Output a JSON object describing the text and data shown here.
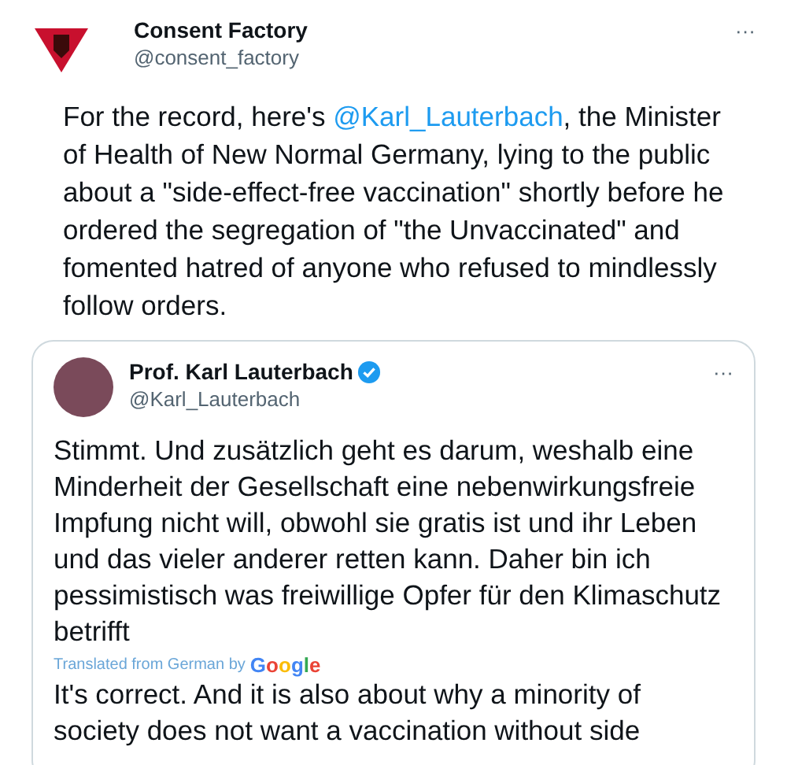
{
  "tweet": {
    "author": {
      "name": "Consent Factory",
      "handle": "@consent_factory"
    },
    "text": {
      "before": "For the record, here's ",
      "mention": "@Karl_Lauterbach",
      "after": ", the Minister of Health of New Normal Germany, lying to the public about a \"side-effect-free vaccination\" shortly before he ordered the segregation of \"the Unvaccinated\" and fomented hatred of anyone who refused to mindlessly follow orders."
    },
    "more": "···",
    "quoted": {
      "author": {
        "name": "Prof. Karl Lauterbach",
        "handle": "@Karl_Lauterbach",
        "verified": true
      },
      "more": "···",
      "text": "Stimmt. Und zusätzlich geht es darum, weshalb eine Minderheit der Gesellschaft eine nebenwirkungsfreie Impfung nicht will, obwohl sie gratis ist und ihr Leben und das vieler anderer retten kann. Daher bin ich pessimistisch was freiwillige Opfer für den Klimaschutz betrifft",
      "translation_label": "Translated from German by",
      "translation_brand": "Google",
      "translation": "It's correct. And it is also about why a minority of society does not want a vaccination without side"
    }
  }
}
